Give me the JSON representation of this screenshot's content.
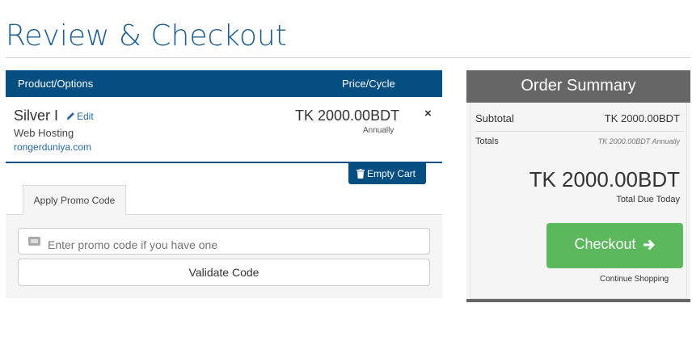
{
  "page": {
    "title": "Review & Checkout"
  },
  "cart": {
    "headers": {
      "product": "Product/Options",
      "price": "Price/Cycle"
    },
    "item": {
      "name": "Silver I",
      "edit_label": "Edit",
      "group": "Web Hosting",
      "domain": "rongerduniya.com",
      "price": "TK 2000.00BDT",
      "cycle": "Annually",
      "remove_label": "×"
    },
    "empty_cart_label": "Empty Cart"
  },
  "promo": {
    "tab_label": "Apply Promo Code",
    "placeholder": "Enter promo code if you have one",
    "validate_label": "Validate Code"
  },
  "summary": {
    "title": "Order Summary",
    "subtotal_label": "Subtotal",
    "subtotal_value": "TK 2000.00BDT",
    "totals_label": "Totals",
    "totals_value": "TK 2000.00BDT Annually",
    "total_amount": "TK 2000.00BDT",
    "total_due_label": "Total Due Today",
    "checkout_label": "Checkout",
    "continue_label": "Continue Shopping"
  },
  "colors": {
    "brand": "#054e81",
    "title": "#1f5e8f",
    "checkout": "#5cb85c",
    "summary_header": "#666666"
  }
}
